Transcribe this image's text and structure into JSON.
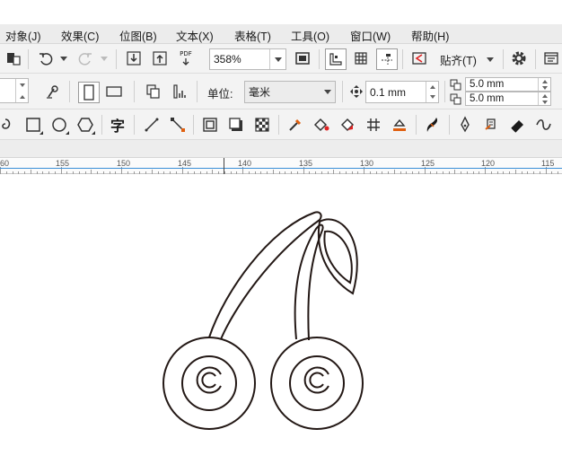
{
  "menubar": {
    "items": [
      {
        "label": "对象(J)"
      },
      {
        "label": "效果(C)"
      },
      {
        "label": "位图(B)"
      },
      {
        "label": "文本(X)"
      },
      {
        "label": "表格(T)"
      },
      {
        "label": "工具(O)"
      },
      {
        "label": "窗口(W)"
      },
      {
        "label": "帮助(H)"
      }
    ]
  },
  "toolbar": {
    "zoom_value": "358%",
    "snap_label": "贴齐(T)",
    "units_label": "单位:",
    "units_value": "毫米",
    "nudge_value": "0.1 mm",
    "dup_x": "5.0 mm",
    "dup_y": "5.0 mm",
    "text_tool_glyph": "字",
    "export_pdf_label": "PDF"
  },
  "ruler": {
    "labels": [
      "60",
      "155",
      "150",
      "145",
      "140",
      "135",
      "130",
      "125",
      "120",
      "115"
    ]
  },
  "colors": {
    "menubar_bg": "#ececec",
    "toolbar_bg": "#f3f3f3",
    "ruler_marker": "#3a8fd8",
    "outline": "#231815"
  },
  "icons": [
    "object-manager-icon",
    "undo-icon",
    "redo-icon",
    "import-icon",
    "export-icon",
    "export-pdf-icon",
    "full-screen-icon",
    "rulers-icon",
    "grid-icon",
    "guidelines-icon",
    "snap-off-icon",
    "settings-icon",
    "welcome-icon",
    "portrait-icon",
    "landscape-icon",
    "all-pages-icon",
    "current-page-icon",
    "nudge-icon",
    "dup-offset-x-icon",
    "dup-offset-y-icon",
    "spiral-icon",
    "rectangle-icon",
    "ellipse-icon",
    "polygon-icon",
    "text-icon",
    "line-icon",
    "connector-icon",
    "shadow-icon",
    "contour-icon",
    "transparency-icon",
    "eyedropper-icon",
    "fill-icon",
    "interactive-fill-icon",
    "mesh-fill-icon",
    "color-eyedropper-icon",
    "smart-fill-icon",
    "pen-icon",
    "knife-icon",
    "eraser-icon",
    "freehand-icon"
  ]
}
